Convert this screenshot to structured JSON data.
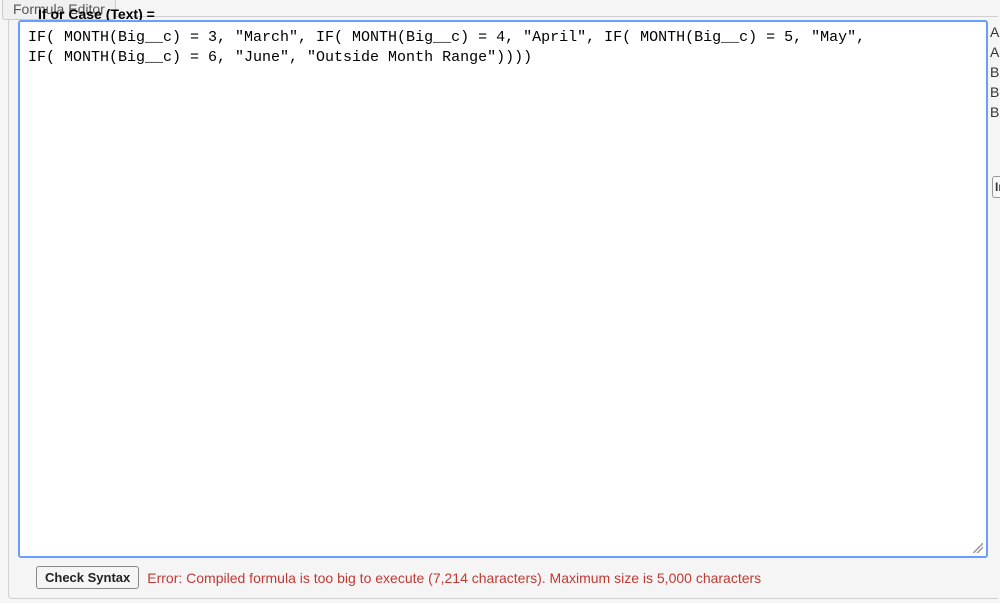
{
  "tab_title": "Formula Editor",
  "field_label": "If or Case (Text) =",
  "formula_value": "IF( MONTH(Big__c) = 3, \"March\", IF( MONTH(Big__c) = 4, \"April\", IF( MONTH(Big__c) = 5, \"May\",\nIF( MONTH(Big__c) = 6, \"June\", \"Outside Month Range\"))))",
  "check_syntax_label": "Check Syntax",
  "error_message": "Error: Compiled formula is too big to execute (7,214 characters). Maximum size is 5,000 characters",
  "sidebar": {
    "items": [
      "A",
      "A",
      "B",
      "B",
      "B"
    ],
    "insert_label": "In"
  }
}
